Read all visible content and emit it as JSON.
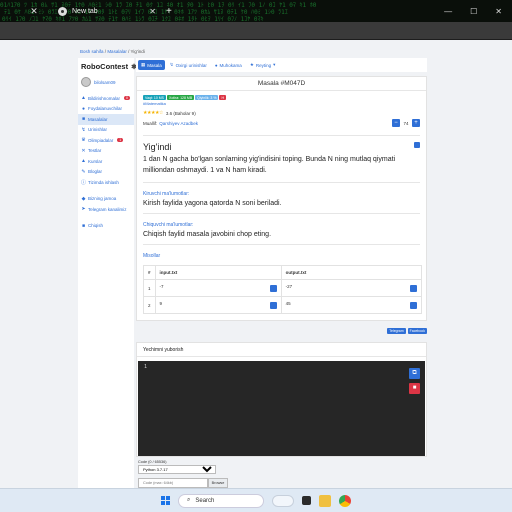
{
  "browser": {
    "tab_title": "New tab",
    "tab_close": "✕",
    "left_close": "✕",
    "new_tab": "+",
    "window_controls": [
      "—",
      "☐",
      "✕"
    ]
  },
  "breadcrumb": {
    "items": [
      "Bosh sahifa",
      "Masalalar",
      "Yig'indi"
    ],
    "separator": "/"
  },
  "sidebar": {
    "brand": "RoboContest",
    "username": "bilolsam09",
    "items": [
      {
        "label": "Bildirishnomalar",
        "badge": "0",
        "icon": "bell"
      },
      {
        "label": "Foydalanuvchilar",
        "icon": "users"
      },
      {
        "label": "Masalalar",
        "icon": "book",
        "active": true
      },
      {
        "label": "Urinishlar",
        "icon": "attempts"
      },
      {
        "label": "Olimpiadalar",
        "badge": "1",
        "icon": "trophy"
      },
      {
        "label": "Testlar",
        "icon": "test"
      },
      {
        "label": "Kurslar",
        "icon": "course"
      },
      {
        "label": "Bloglar",
        "icon": "blog"
      },
      {
        "label": "Tizimda ishlash",
        "icon": "info"
      }
    ],
    "extra_items": [
      {
        "label": "Bizning jamoa",
        "icon": "team"
      },
      {
        "label": "Telegram kanalimiz",
        "icon": "telegram"
      }
    ],
    "logout": "Chiqish"
  },
  "tabs": [
    {
      "label": "Masala",
      "active": true
    },
    {
      "label": "Oxirgi urinishlar"
    },
    {
      "label": "Muhokama"
    },
    {
      "label": "Reyting"
    }
  ],
  "problem": {
    "header": "Masala #M047D",
    "badges": [
      "Vaqt: 10 MS",
      "Xotira: 128 MB",
      "Qiyinlik: 3 %",
      "H"
    ],
    "tag": "#Matematika",
    "rating": "3.6 (Baholar 9)",
    "author_label": "Muallif:",
    "author": "Qarshiyev Azadbek",
    "votes": "74",
    "title": "Yig'indi",
    "statement": "1 dan N gacha bo'lgan sonlarning yig'indisini toping. Bunda N ning mutlaq qiymati milliondan oshmaydi. 1 va N ham kiradi.",
    "input_label": "Kiruvchi ma'lumotlar:",
    "input_text": "Kirish faylida yagona qatorda N soni beriladi.",
    "output_label": "Chiquvchi ma'lumotlar:",
    "output_text": "Chiqish faylid masala javobini chop eting.",
    "examples_label": "Misollar",
    "examples_headers": [
      "#",
      "input.txt",
      "output.txt"
    ],
    "examples": [
      {
        "n": "1",
        "input": "-7",
        "output": "-27"
      },
      {
        "n": "2",
        "input": "9",
        "output": "45"
      }
    ],
    "share": [
      "Telegram",
      "Facebook"
    ]
  },
  "submit": {
    "header": "Yechimni yuborish",
    "line_number": "1",
    "code_label": "Code (0 / 65536)",
    "language": "Python 3.7.17",
    "file_placeholder": "Code (max: 64kb)",
    "browse": "Browse"
  },
  "taskbar": {
    "search": "Search"
  }
}
